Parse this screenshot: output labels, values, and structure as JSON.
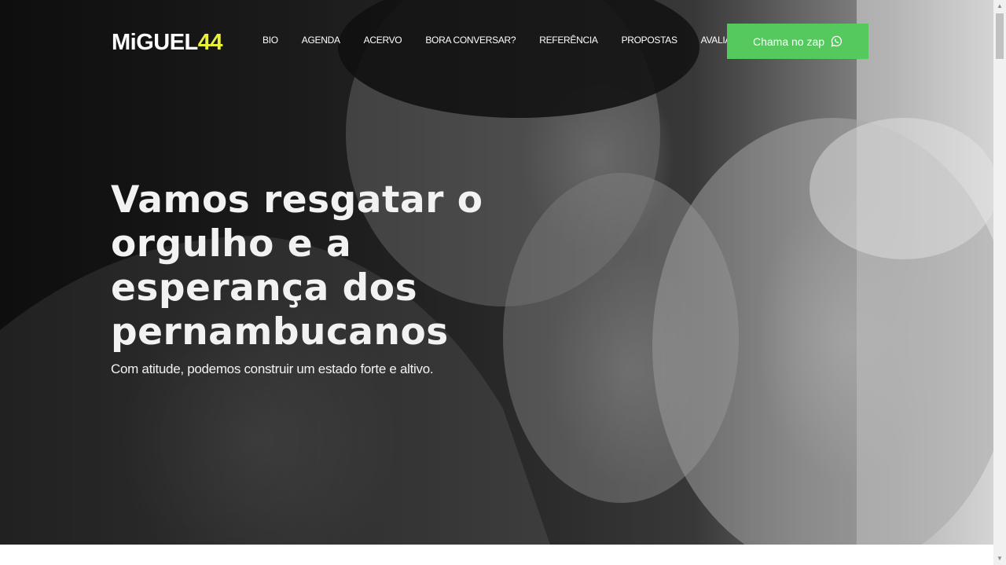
{
  "brand": {
    "name": "MiGUEL",
    "number": "44"
  },
  "nav": {
    "items": [
      {
        "label": "BIO"
      },
      {
        "label": "AGENDA"
      },
      {
        "label": "ACERVO"
      },
      {
        "label": "BORA CONVERSAR?"
      },
      {
        "label": "REFERÊNCIA"
      },
      {
        "label": "PROPOSTAS"
      },
      {
        "label": "AVALIAÇÕES"
      }
    ]
  },
  "cta": {
    "label": "Chama no zap",
    "icon": "whatsapp-icon",
    "color": "#55c95e"
  },
  "hero": {
    "headline": "Vamos resgatar o orgulho e a esperança dos pernambucanos",
    "subtitle": "Com atitude, podemos construir um estado forte e altivo."
  },
  "colors": {
    "accent": "#e8f03a",
    "cta": "#55c95e",
    "text": "#ffffff"
  }
}
